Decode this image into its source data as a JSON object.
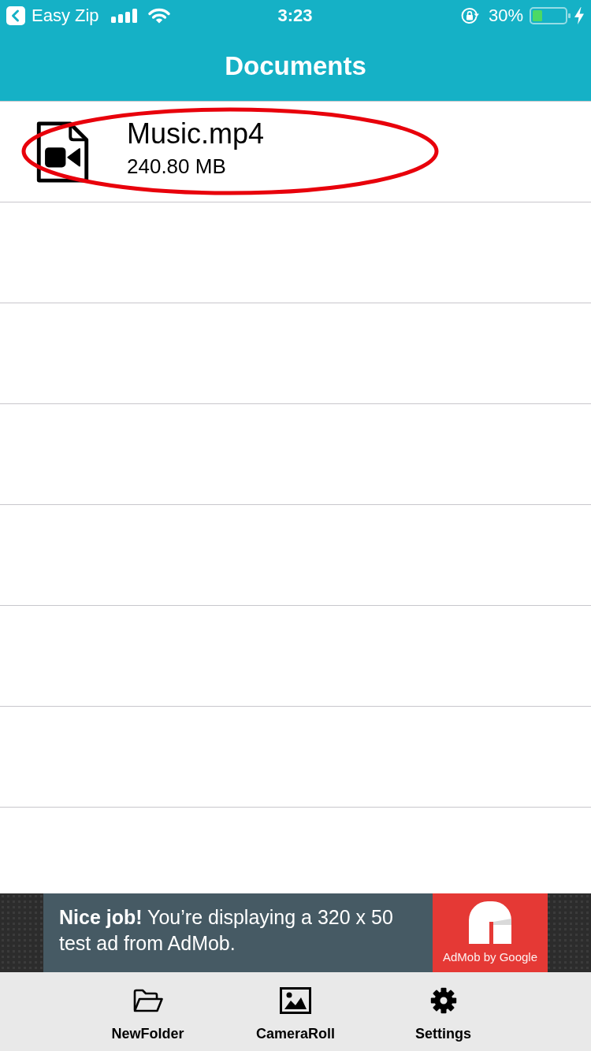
{
  "status_bar": {
    "back_label": "Easy Zip",
    "time": "3:23",
    "battery": "30%"
  },
  "nav_bar": {
    "title": "Documents"
  },
  "files": [
    {
      "kind": "video",
      "name": "Music.mp4",
      "size": "240.80 MB",
      "highlighted": true
    }
  ],
  "ad": {
    "text": "**Nice job!** You’re displaying a 320 x 50 test ad from AdMob.",
    "brand": "AdMob by Google"
  },
  "toolbar": {
    "items": [
      {
        "kind": "folder",
        "label": "NewFolder"
      },
      {
        "kind": "image",
        "label": "CameraRoll"
      },
      {
        "kind": "gear",
        "label": "Settings"
      }
    ]
  }
}
